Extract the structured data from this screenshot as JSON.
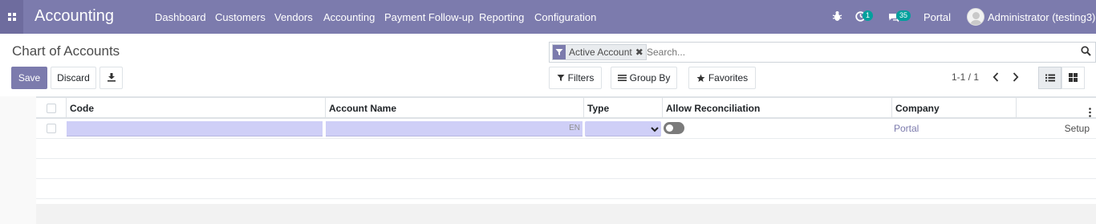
{
  "app": {
    "title": "Accounting"
  },
  "menu": {
    "items": [
      {
        "label": "Dashboard"
      },
      {
        "label": "Customers"
      },
      {
        "label": "Vendors"
      },
      {
        "label": "Accounting"
      },
      {
        "label": "Payment Follow-up"
      },
      {
        "label": "Reporting"
      },
      {
        "label": "Configuration"
      }
    ]
  },
  "systray": {
    "activity_count": "1",
    "message_count": "35",
    "company": "Portal",
    "user": "Administrator (testing3)"
  },
  "breadcrumb": {
    "title": "Chart of Accounts"
  },
  "search": {
    "facet_label": "Active Account",
    "placeholder": "Search..."
  },
  "buttons": {
    "save": "Save",
    "discard": "Discard",
    "filters": "Filters",
    "group_by": "Group By",
    "favorites": "Favorites"
  },
  "pager": {
    "value": "1-1 / 1"
  },
  "table": {
    "columns": [
      {
        "label": "Code"
      },
      {
        "label": "Account Name"
      },
      {
        "label": "Type"
      },
      {
        "label": "Allow Reconciliation"
      },
      {
        "label": "Company"
      }
    ],
    "edit_row": {
      "code": "",
      "account_name": "",
      "lang_tag": "EN",
      "type": "",
      "allow_reconciliation": false,
      "company": "Portal",
      "setup": "Setup"
    }
  },
  "colors": {
    "brand": "#7c7bad",
    "badge": "#00a09d",
    "edit_field": "#cfcff7"
  }
}
